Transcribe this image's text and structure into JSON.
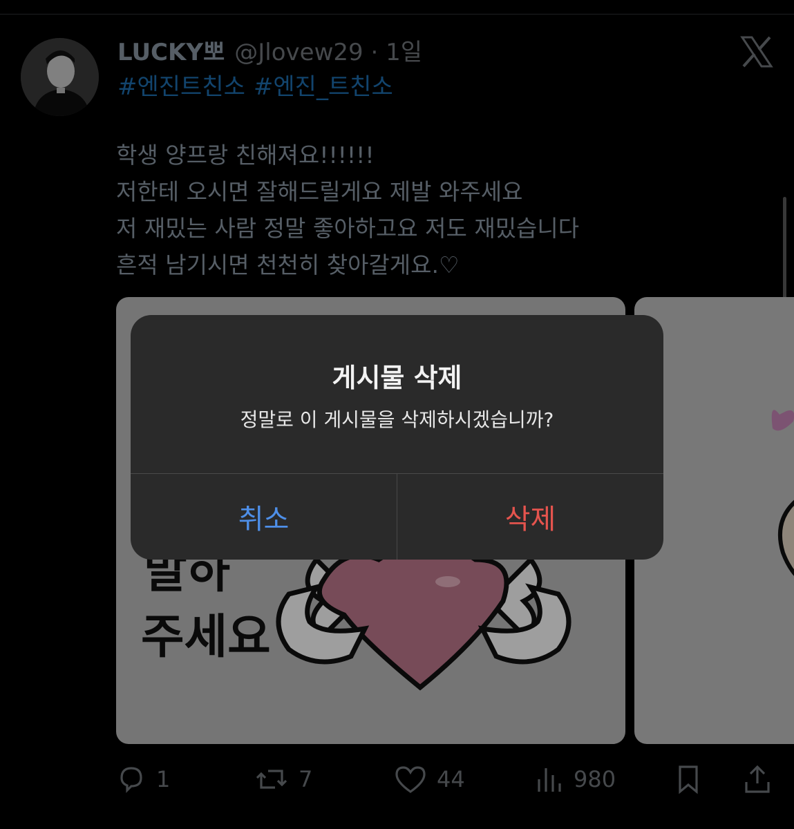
{
  "tweet": {
    "display_name": "LUCKY뽀",
    "handle_time": "@Jlovew29 · 1일",
    "hashtags": [
      "#엔진트친소",
      "#엔진_트친소"
    ],
    "lines": [
      "학생 양프랑 친해져요!!!!!!",
      "저한테 오시면 잘해드릴게요 제발 와주세요",
      "저 재밌는 사람 정말 좋아하고요 저도 재밌습니다",
      "흔적 남기시면 천천히 찾아갈게요.♡"
    ],
    "media_text": "주세요"
  },
  "actions": {
    "replies": "1",
    "reposts": "7",
    "likes": "44",
    "views": "980"
  },
  "dialog": {
    "title": "게시물 삭제",
    "message": "정말로 이 게시물을 삭제하시겠습니까?",
    "cancel_label": "취소",
    "delete_label": "삭제",
    "cancel_color": "#4e8fe8",
    "delete_color": "#e5544e"
  },
  "icons": {
    "reply": "reply-icon",
    "repost": "repost-icon",
    "like": "heart-icon",
    "views": "views-icon",
    "bookmark": "bookmark-icon",
    "share": "share-icon",
    "brand": "x-logo-icon"
  }
}
